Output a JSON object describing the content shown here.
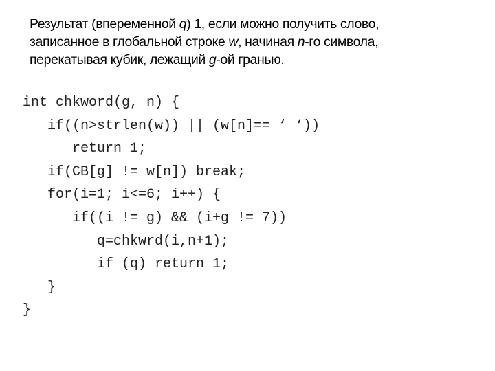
{
  "description": {
    "lines": [
      [
        {
          "text": "Результат (впеременной ",
          "italic": false
        },
        {
          "text": "q",
          "italic": true
        },
        {
          "text": ")  1, если можно получить слово,",
          "italic": false
        }
      ],
      [
        {
          "text": "записанное в глобальной строке ",
          "italic": false
        },
        {
          "text": "w",
          "italic": true
        },
        {
          "text": ", начиная ",
          "italic": false
        },
        {
          "text": "n",
          "italic": true
        },
        {
          "text": "-го символа,",
          "italic": false
        }
      ],
      [
        {
          "text": "перекатывая кубик, лежащий ",
          "italic": false
        },
        {
          "text": "g",
          "italic": true
        },
        {
          "text": "-ой гранью.",
          "italic": false
        }
      ]
    ]
  },
  "code": {
    "lines": [
      {
        "indent": 0,
        "text": "int chkword(g, n) {"
      },
      {
        "indent": 1,
        "text": "if((n>strlen(w)) || (w[n]== ‘ ‘))"
      },
      {
        "indent": 2,
        "text": "return 1;"
      },
      {
        "indent": 1,
        "text": "if(CB[g] != w[n]) break;"
      },
      {
        "indent": 1,
        "text": "for(i=1; i<=6; i++) {"
      },
      {
        "indent": 2,
        "text": "if((i != g) && (i+g != 7))"
      },
      {
        "indent": 3,
        "text": "q=chkwrd(i,n+1);"
      },
      {
        "indent": 3,
        "text": "if (q) return 1;"
      },
      {
        "indent": 1,
        "text": "}"
      },
      {
        "indent": 0,
        "text": "}"
      }
    ]
  }
}
